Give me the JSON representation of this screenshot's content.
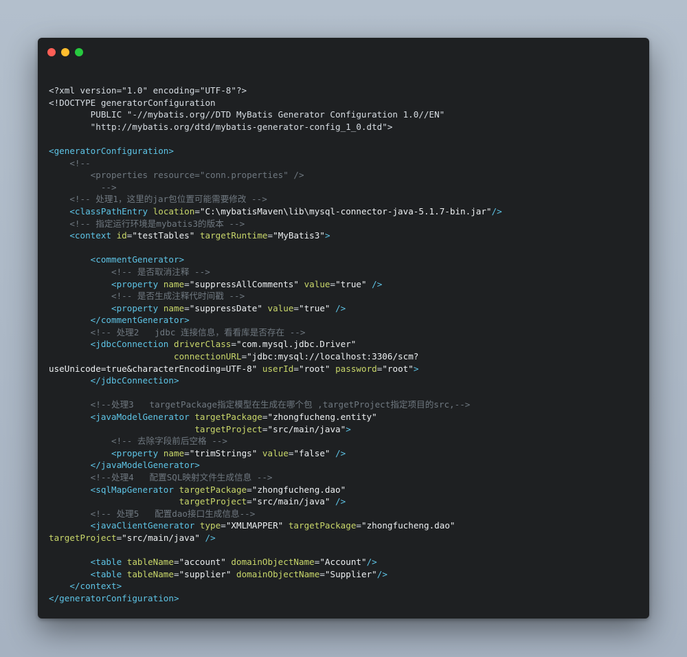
{
  "window": {
    "controls": [
      {
        "name": "close",
        "color": "#ff5f56"
      },
      {
        "name": "minimize",
        "color": "#ffbd2e"
      },
      {
        "name": "maximize",
        "color": "#27c93f"
      }
    ]
  },
  "colors": {
    "background": "#a9b5c3",
    "editor": "#1e2022",
    "tag": "#5ec4e6",
    "attribute": "#c9d76a",
    "value": "#eceff1",
    "comment": "#6f7880"
  },
  "code_lines": [
    [
      [
        "meta",
        "<?xml version=\"1.0\" encoding=\"UTF-8\"?>"
      ]
    ],
    [
      [
        "meta",
        "<!DOCTYPE generatorConfiguration"
      ]
    ],
    [
      [
        "meta",
        "        PUBLIC \"-//mybatis.org//DTD MyBatis Generator Configuration 1.0//EN\""
      ]
    ],
    [
      [
        "meta",
        "        \"http://mybatis.org/dtd/mybatis-generator-config_1_0.dtd\">"
      ]
    ],
    [],
    [
      [
        "tag",
        "<generatorConfiguration>"
      ]
    ],
    [
      [
        "cmt",
        "    <!--"
      ]
    ],
    [
      [
        "cmt",
        "        <properties resource=\"conn.properties\" />"
      ]
    ],
    [
      [
        "cmt",
        "          -->"
      ]
    ],
    [
      [
        "cmt",
        "    <!-- 处理1，这里的jar包位置可能需要修改 -->"
      ]
    ],
    [
      [
        "tag",
        "    <classPathEntry "
      ],
      [
        "attr",
        "location"
      ],
      [
        "plain",
        "="
      ],
      [
        "val",
        "\"C:\\mybatisMaven\\lib\\mysql-connector-java-5.1.7-bin.jar\""
      ],
      [
        "tag",
        "/>"
      ]
    ],
    [
      [
        "cmt",
        "    <!-- 指定运行环境是mybatis3的版本 -->"
      ]
    ],
    [
      [
        "tag",
        "    <context "
      ],
      [
        "attr",
        "id"
      ],
      [
        "plain",
        "="
      ],
      [
        "val",
        "\"testTables\""
      ],
      [
        "plain",
        " "
      ],
      [
        "attr",
        "targetRuntime"
      ],
      [
        "plain",
        "="
      ],
      [
        "val",
        "\"MyBatis3\""
      ],
      [
        "tag",
        ">"
      ]
    ],
    [],
    [
      [
        "tag",
        "        <commentGenerator>"
      ]
    ],
    [
      [
        "cmt",
        "            <!-- 是否取消注释 -->"
      ]
    ],
    [
      [
        "tag",
        "            <property "
      ],
      [
        "attr",
        "name"
      ],
      [
        "plain",
        "="
      ],
      [
        "val",
        "\"suppressAllComments\""
      ],
      [
        "plain",
        " "
      ],
      [
        "attr",
        "value"
      ],
      [
        "plain",
        "="
      ],
      [
        "val",
        "\"true\""
      ],
      [
        "tag",
        " />"
      ]
    ],
    [
      [
        "cmt",
        "            <!-- 是否生成注释代时间戳 -->"
      ]
    ],
    [
      [
        "tag",
        "            <property "
      ],
      [
        "attr",
        "name"
      ],
      [
        "plain",
        "="
      ],
      [
        "val",
        "\"suppressDate\""
      ],
      [
        "plain",
        " "
      ],
      [
        "attr",
        "value"
      ],
      [
        "plain",
        "="
      ],
      [
        "val",
        "\"true\""
      ],
      [
        "tag",
        " />"
      ]
    ],
    [
      [
        "tag",
        "        </commentGenerator>"
      ]
    ],
    [
      [
        "cmt",
        "        <!-- 处理2   jdbc 连接信息，看看库是否存在 -->"
      ]
    ],
    [
      [
        "tag",
        "        <jdbcConnection "
      ],
      [
        "attr",
        "driverClass"
      ],
      [
        "plain",
        "="
      ],
      [
        "val",
        "\"com.mysql.jdbc.Driver\""
      ]
    ],
    [
      [
        "plain",
        "                        "
      ],
      [
        "attr",
        "connectionURL"
      ],
      [
        "plain",
        "="
      ],
      [
        "val",
        "\"jdbc:mysql://localhost:3306/scm?"
      ]
    ],
    [
      [
        "val",
        "useUnicode=true&characterEncoding=UTF-8\""
      ],
      [
        "plain",
        " "
      ],
      [
        "attr",
        "userId"
      ],
      [
        "plain",
        "="
      ],
      [
        "val",
        "\"root\""
      ],
      [
        "plain",
        " "
      ],
      [
        "attr",
        "password"
      ],
      [
        "plain",
        "="
      ],
      [
        "val",
        "\"root\""
      ],
      [
        "tag",
        ">"
      ]
    ],
    [
      [
        "tag",
        "        </jdbcConnection>"
      ]
    ],
    [],
    [
      [
        "cmt",
        "        <!--处理3   targetPackage指定模型在生成在哪个包 ,targetProject指定项目的src,-->"
      ]
    ],
    [
      [
        "tag",
        "        <javaModelGenerator "
      ],
      [
        "attr",
        "targetPackage"
      ],
      [
        "plain",
        "="
      ],
      [
        "val",
        "\"zhongfucheng.entity\""
      ]
    ],
    [
      [
        "plain",
        "                            "
      ],
      [
        "attr",
        "targetProject"
      ],
      [
        "plain",
        "="
      ],
      [
        "val",
        "\"src/main/java\""
      ],
      [
        "tag",
        ">"
      ]
    ],
    [
      [
        "cmt",
        "            <!-- 去除字段前后空格 -->"
      ]
    ],
    [
      [
        "tag",
        "            <property "
      ],
      [
        "attr",
        "name"
      ],
      [
        "plain",
        "="
      ],
      [
        "val",
        "\"trimStrings\""
      ],
      [
        "plain",
        " "
      ],
      [
        "attr",
        "value"
      ],
      [
        "plain",
        "="
      ],
      [
        "val",
        "\"false\""
      ],
      [
        "tag",
        " />"
      ]
    ],
    [
      [
        "tag",
        "        </javaModelGenerator>"
      ]
    ],
    [
      [
        "cmt",
        "        <!--处理4   配置SQL映射文件生成信息 -->"
      ]
    ],
    [
      [
        "tag",
        "        <sqlMapGenerator "
      ],
      [
        "attr",
        "targetPackage"
      ],
      [
        "plain",
        "="
      ],
      [
        "val",
        "\"zhongfucheng.dao\""
      ]
    ],
    [
      [
        "plain",
        "                         "
      ],
      [
        "attr",
        "targetProject"
      ],
      [
        "plain",
        "="
      ],
      [
        "val",
        "\"src/main/java\""
      ],
      [
        "tag",
        " />"
      ]
    ],
    [
      [
        "cmt",
        "        <!-- 处理5   配置dao接口生成信息-->"
      ]
    ],
    [
      [
        "tag",
        "        <javaClientGenerator "
      ],
      [
        "attr",
        "type"
      ],
      [
        "plain",
        "="
      ],
      [
        "val",
        "\"XMLMAPPER\""
      ],
      [
        "plain",
        " "
      ],
      [
        "attr",
        "targetPackage"
      ],
      [
        "plain",
        "="
      ],
      [
        "val",
        "\"zhongfucheng.dao\""
      ]
    ],
    [
      [
        "attr",
        "targetProject"
      ],
      [
        "plain",
        "="
      ],
      [
        "val",
        "\"src/main/java\""
      ],
      [
        "tag",
        " />"
      ]
    ],
    [],
    [
      [
        "tag",
        "        <table "
      ],
      [
        "attr",
        "tableName"
      ],
      [
        "plain",
        "="
      ],
      [
        "val",
        "\"account\""
      ],
      [
        "plain",
        " "
      ],
      [
        "attr",
        "domainObjectName"
      ],
      [
        "plain",
        "="
      ],
      [
        "val",
        "\"Account\""
      ],
      [
        "tag",
        "/>"
      ]
    ],
    [
      [
        "tag",
        "        <table "
      ],
      [
        "attr",
        "tableName"
      ],
      [
        "plain",
        "="
      ],
      [
        "val",
        "\"supplier\""
      ],
      [
        "plain",
        " "
      ],
      [
        "attr",
        "domainObjectName"
      ],
      [
        "plain",
        "="
      ],
      [
        "val",
        "\"Supplier\""
      ],
      [
        "tag",
        "/>"
      ]
    ],
    [
      [
        "tag",
        "    </context>"
      ]
    ],
    [
      [
        "tag",
        "</generatorConfiguration>"
      ]
    ]
  ]
}
